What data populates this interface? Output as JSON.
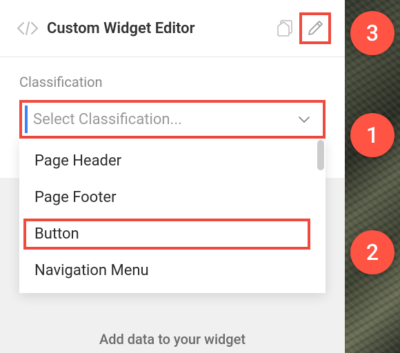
{
  "header": {
    "title": "Custom Widget Editor",
    "icons": {
      "code": "code-icon",
      "clipboard": "clipboard-icon",
      "pencil": "pencil-icon"
    }
  },
  "classification": {
    "label": "Classification",
    "placeholder": "Select Classification...",
    "options": [
      "Page Header",
      "Page Footer",
      "Button",
      "Navigation Menu"
    ],
    "highlighted_index": 2
  },
  "lower_section": {
    "text": "Add data to your widget"
  },
  "callouts": {
    "c1": "1",
    "c2": "2",
    "c3": "3"
  }
}
